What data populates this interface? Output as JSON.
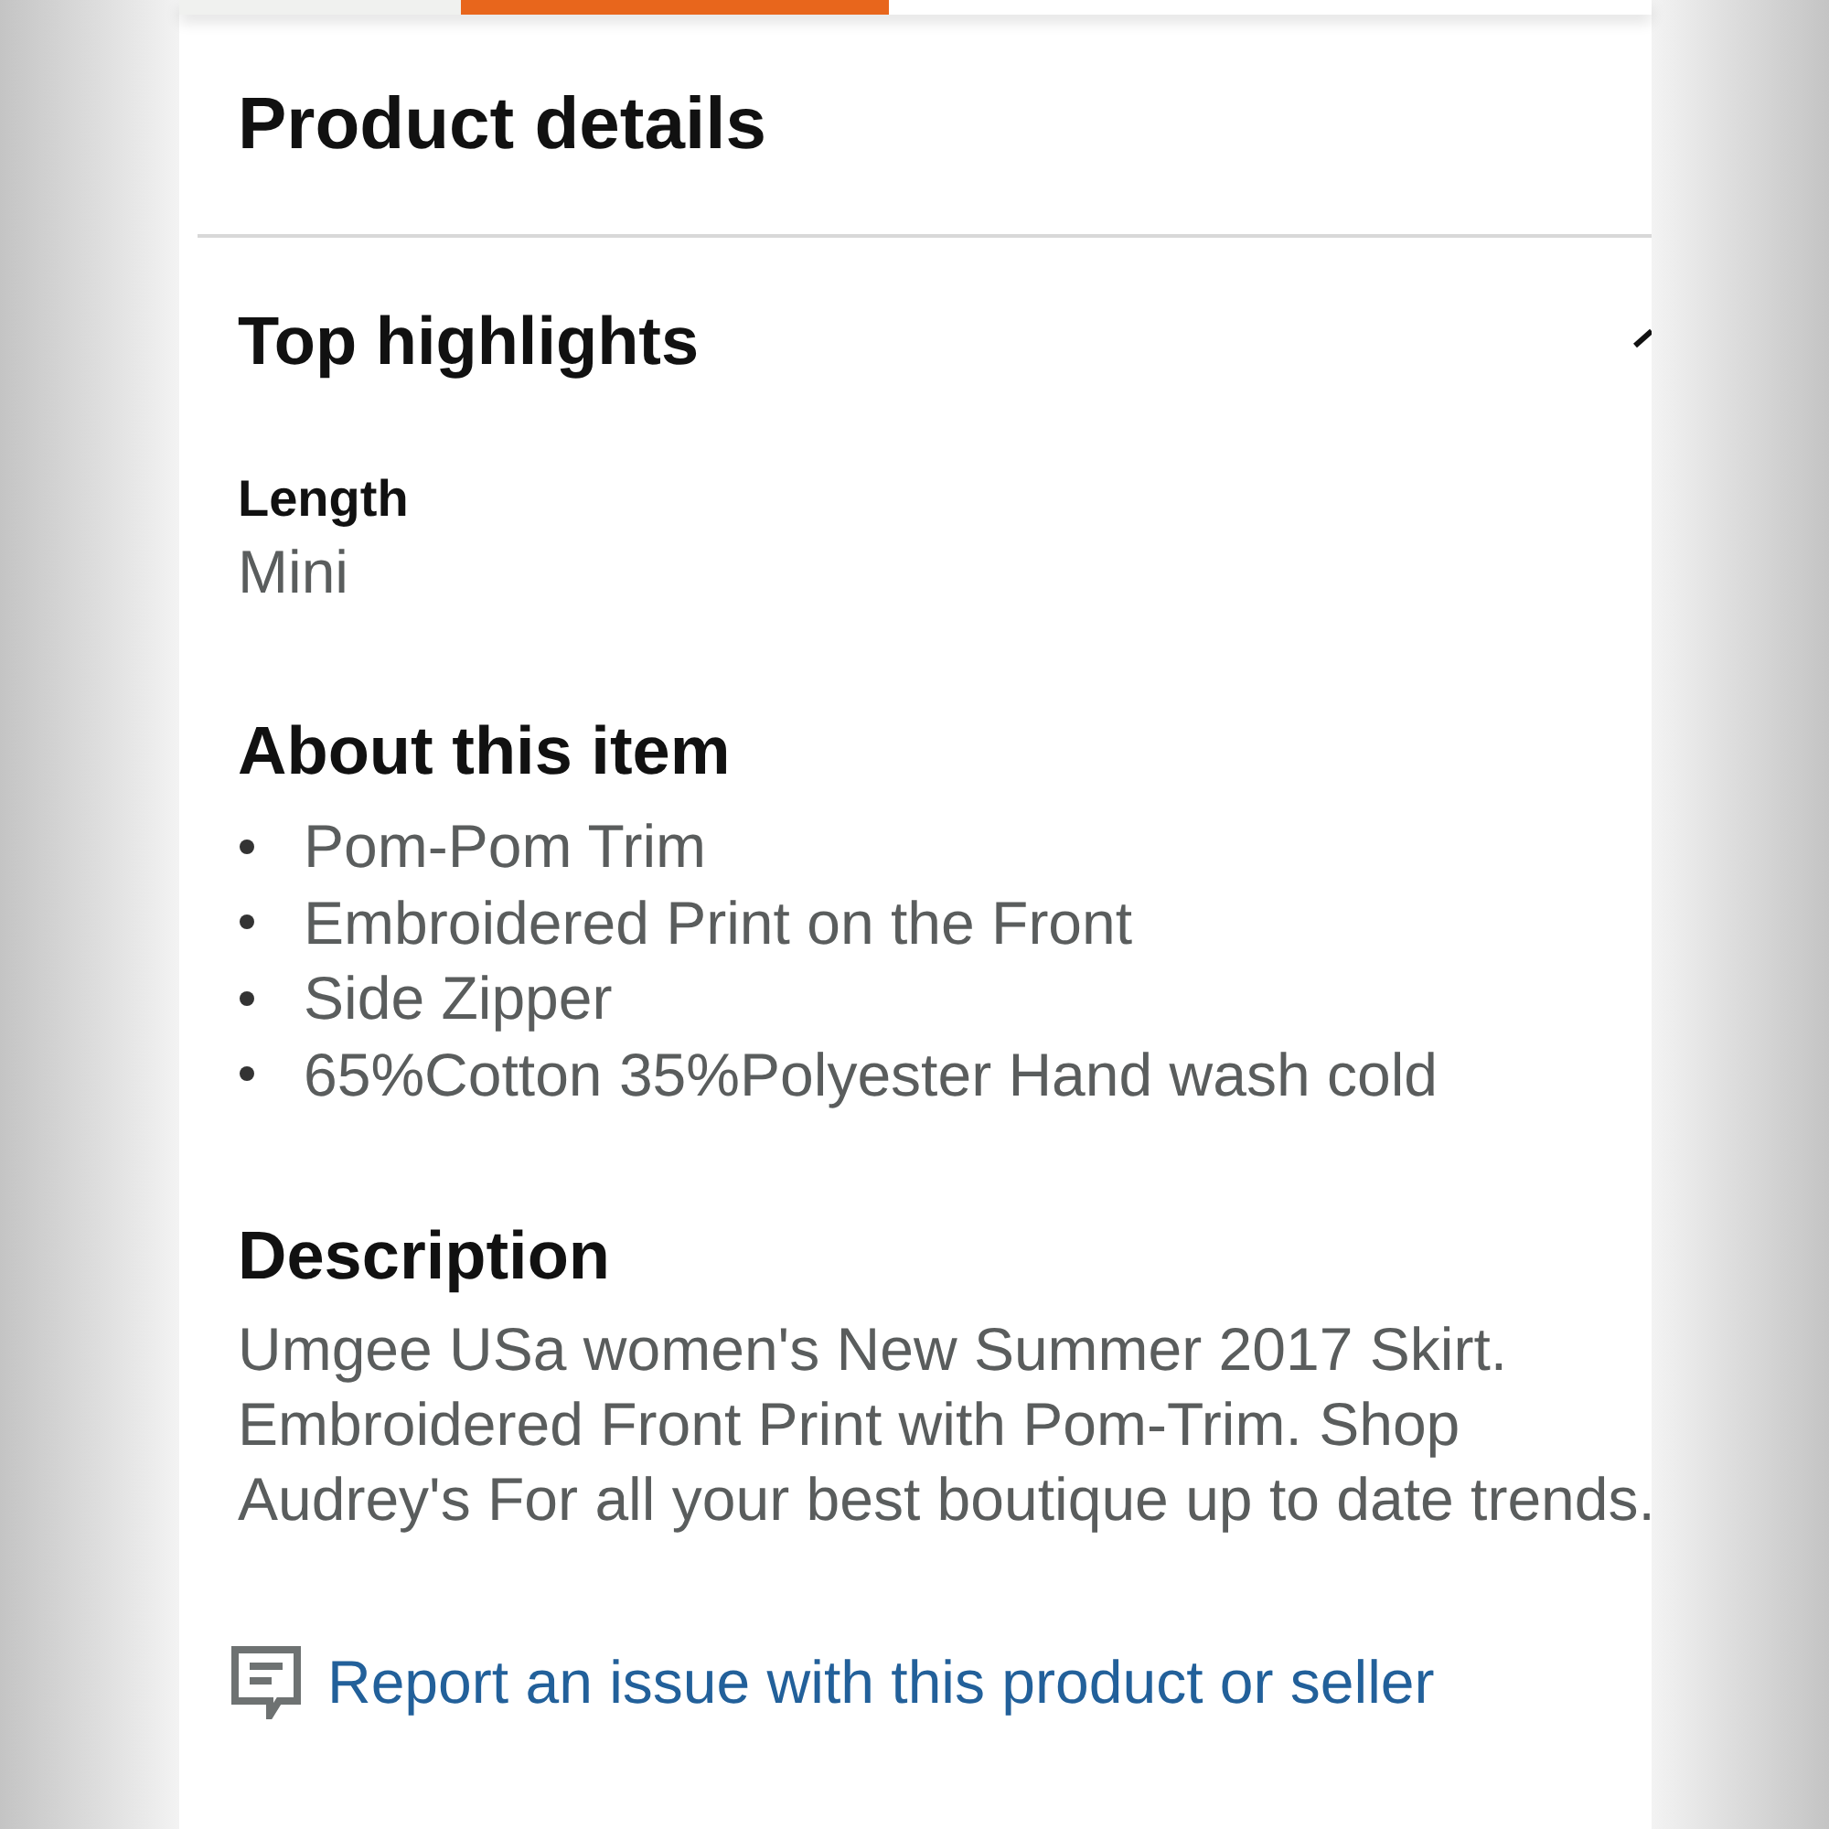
{
  "tabs": [
    {
      "selected": false
    },
    {
      "selected": true
    }
  ],
  "page_title": "Product details",
  "top_highlights": {
    "title": "Top highlights",
    "expanded": true,
    "attributes": [
      {
        "label": "Length",
        "value": "Mini"
      }
    ]
  },
  "about": {
    "title": "About this item",
    "bullets": [
      "Pom-Pom Trim",
      "Embroidered Print on the Front",
      "Side Zipper",
      "65%Cotton 35%Polyester Hand wash cold"
    ]
  },
  "description": {
    "title": "Description",
    "text": "Umgee USa women's New Summer 2017 Skirt. Embroidered Front Print with Pom-Trim. Shop Audrey's For all your best boutique up to date trends."
  },
  "report_link": "Report an issue with this product or seller"
}
